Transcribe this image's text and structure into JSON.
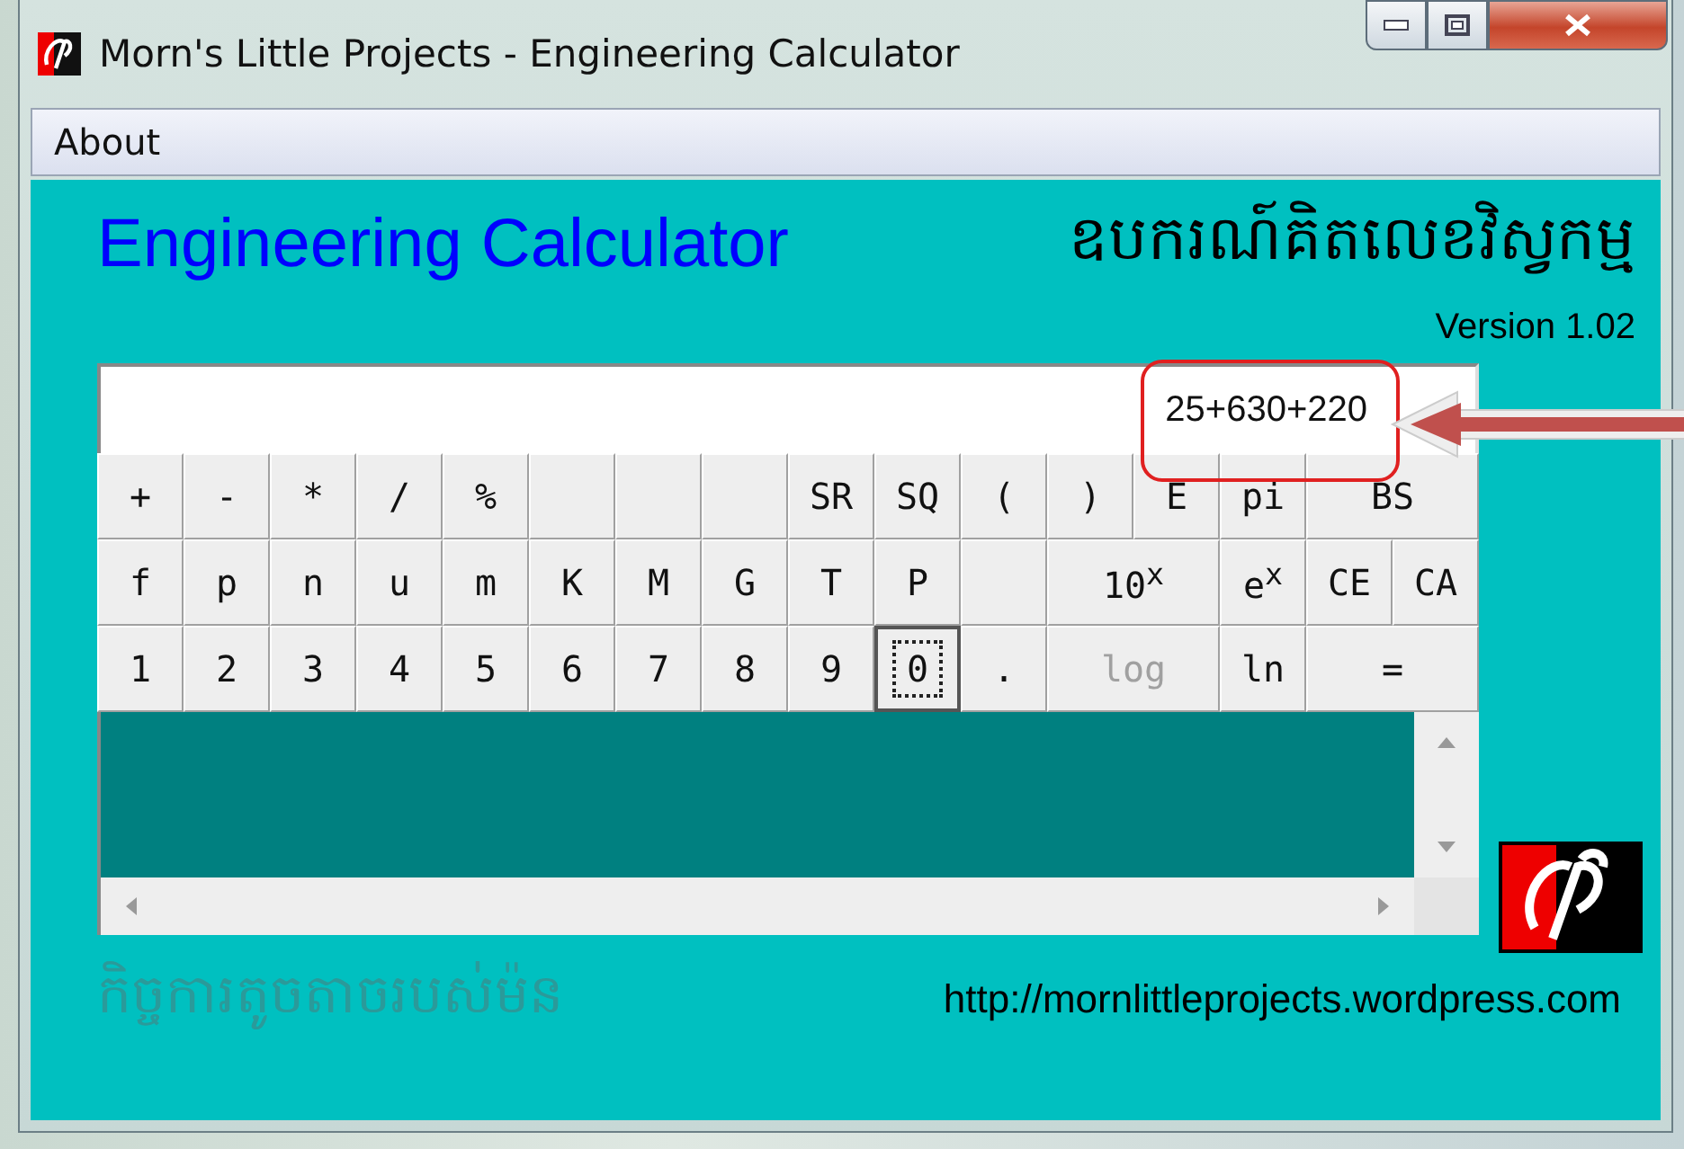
{
  "window": {
    "title": "Morn's Little Projects - Engineering Calculator"
  },
  "menu": [
    "About"
  ],
  "header": {
    "title": "Engineering Calculator",
    "khmer_title": "ឧបករណ៍គិតលេខវិស្វកម្ម",
    "version": "Version 1.02"
  },
  "display": {
    "value": "25+630+220"
  },
  "keypad": [
    [
      {
        "kind": "key",
        "label": "+",
        "wide": false,
        "disabled": false,
        "focused": false
      },
      {
        "kind": "key",
        "label": "-",
        "wide": false,
        "disabled": false,
        "focused": false
      },
      {
        "kind": "key",
        "label": "*",
        "wide": false,
        "disabled": false,
        "focused": false
      },
      {
        "kind": "key",
        "label": "/",
        "wide": false,
        "disabled": false,
        "focused": false
      },
      {
        "kind": "key",
        "label": "%",
        "wide": false,
        "disabled": false,
        "focused": false
      },
      {
        "kind": "blank",
        "wide": false,
        "disabled": false,
        "focused": false
      },
      {
        "kind": "blank",
        "wide": false,
        "disabled": false,
        "focused": false
      },
      {
        "kind": "blank",
        "wide": false,
        "disabled": false,
        "focused": false
      },
      {
        "kind": "key",
        "label": "SR",
        "wide": false,
        "disabled": false,
        "focused": false
      },
      {
        "kind": "key",
        "label": "SQ",
        "wide": false,
        "disabled": false,
        "focused": false
      },
      {
        "kind": "key",
        "label": "(",
        "wide": false,
        "disabled": false,
        "focused": false
      },
      {
        "kind": "key",
        "label": ")",
        "wide": false,
        "disabled": false,
        "focused": false
      },
      {
        "kind": "key",
        "label": "E",
        "wide": false,
        "disabled": false,
        "focused": false
      },
      {
        "kind": "key",
        "label": "pi",
        "wide": false,
        "disabled": false,
        "focused": false
      },
      {
        "kind": "key",
        "label": "BS",
        "wide": true,
        "disabled": false,
        "focused": false
      }
    ],
    [
      {
        "kind": "key",
        "label": "f",
        "wide": false,
        "disabled": false,
        "focused": false
      },
      {
        "kind": "key",
        "label": "p",
        "wide": false,
        "disabled": false,
        "focused": false
      },
      {
        "kind": "key",
        "label": "n",
        "wide": false,
        "disabled": false,
        "focused": false
      },
      {
        "kind": "key",
        "label": "u",
        "wide": false,
        "disabled": false,
        "focused": false
      },
      {
        "kind": "key",
        "label": "m",
        "wide": false,
        "disabled": false,
        "focused": false
      },
      {
        "kind": "key",
        "label": "K",
        "wide": false,
        "disabled": false,
        "focused": false
      },
      {
        "kind": "key",
        "label": "M",
        "wide": false,
        "disabled": false,
        "focused": false
      },
      {
        "kind": "key",
        "label": "G",
        "wide": false,
        "disabled": false,
        "focused": false
      },
      {
        "kind": "key",
        "label": "T",
        "wide": false,
        "disabled": false,
        "focused": false
      },
      {
        "kind": "key",
        "label": "P",
        "wide": false,
        "disabled": false,
        "focused": false
      },
      {
        "kind": "blank",
        "wide": false,
        "disabled": false,
        "focused": false
      },
      {
        "kind": "key",
        "label": "10$^{x}$",
        "wide": true,
        "disabled": false,
        "focused": false
      },
      {
        "kind": "key",
        "label": "e$^{x}$",
        "wide": false,
        "disabled": false,
        "focused": false
      },
      {
        "kind": "key",
        "label": "CE",
        "wide": false,
        "disabled": false,
        "focused": false
      },
      {
        "kind": "key",
        "label": "CA",
        "wide": false,
        "disabled": false,
        "focused": false
      }
    ],
    [
      {
        "kind": "key",
        "label": "1",
        "wide": false,
        "disabled": false,
        "focused": false
      },
      {
        "kind": "key",
        "label": "2",
        "wide": false,
        "disabled": false,
        "focused": false
      },
      {
        "kind": "key",
        "label": "3",
        "wide": false,
        "disabled": false,
        "focused": false
      },
      {
        "kind": "key",
        "label": "4",
        "wide": false,
        "disabled": false,
        "focused": false
      },
      {
        "kind": "key",
        "label": "5",
        "wide": false,
        "disabled": false,
        "focused": false
      },
      {
        "kind": "key",
        "label": "6",
        "wide": false,
        "disabled": false,
        "focused": false
      },
      {
        "kind": "key",
        "label": "7",
        "wide": false,
        "disabled": false,
        "focused": false
      },
      {
        "kind": "key",
        "label": "8",
        "wide": false,
        "disabled": false,
        "focused": false
      },
      {
        "kind": "key",
        "label": "9",
        "wide": false,
        "disabled": false,
        "focused": false
      },
      {
        "kind": "key",
        "label": "0",
        "wide": false,
        "disabled": false,
        "focused": true
      },
      {
        "kind": "key",
        "label": ".",
        "wide": false,
        "disabled": false,
        "focused": false
      },
      {
        "kind": "key",
        "label": "log",
        "wide": true,
        "disabled": true,
        "focused": false
      },
      {
        "kind": "key",
        "label": "ln",
        "wide": false,
        "disabled": false,
        "focused": false
      },
      {
        "kind": "key",
        "label": "=",
        "wide": true,
        "disabled": false,
        "focused": false
      }
    ]
  ],
  "footer": {
    "khmer_text": "កិច្ចការតូចតាចរបស់ម៉ន",
    "url": "http://mornlittleprojects.wordpress.com"
  },
  "annotations": [
    {
      "kind": "highlight"
    },
    {
      "kind": "arrow"
    }
  ]
}
